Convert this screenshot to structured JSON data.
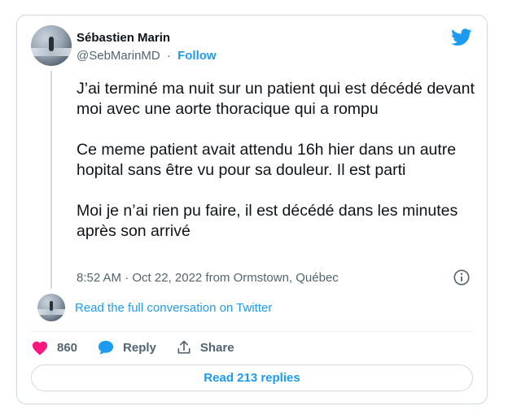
{
  "author": {
    "name": "Sébastien Marin",
    "handle": "@SebMarinMD",
    "separator": "·",
    "follow_label": "Follow"
  },
  "brand": {
    "icon": "twitter-bird-icon",
    "color": "#1d9bf0"
  },
  "tweet": {
    "paragraphs": [
      "J’ai terminé ma nuit sur un patient qui est décédé devant moi avec une aorte thoracique qui a rompu",
      "Ce meme patient avait attendu 16h hier dans un autre hopital sans être vu pour sa douleur. Il est parti",
      "Moi je n’ai rien pu faire, il est décédé dans les minutes après son arrivé"
    ],
    "timestamp": "8:52 AM · Oct 22, 2022 from Ormstown, Québec",
    "info_icon": "info-icon"
  },
  "conversation": {
    "link_label": "Read the full conversation on Twitter"
  },
  "actions": {
    "like_count": "860",
    "like_icon": "heart-icon",
    "reply_label": "Reply",
    "reply_icon": "speech-bubble-icon",
    "share_label": "Share",
    "share_icon": "share-upload-icon",
    "like_color": "#f91880"
  },
  "footer": {
    "read_replies_label": "Read 213 replies"
  }
}
